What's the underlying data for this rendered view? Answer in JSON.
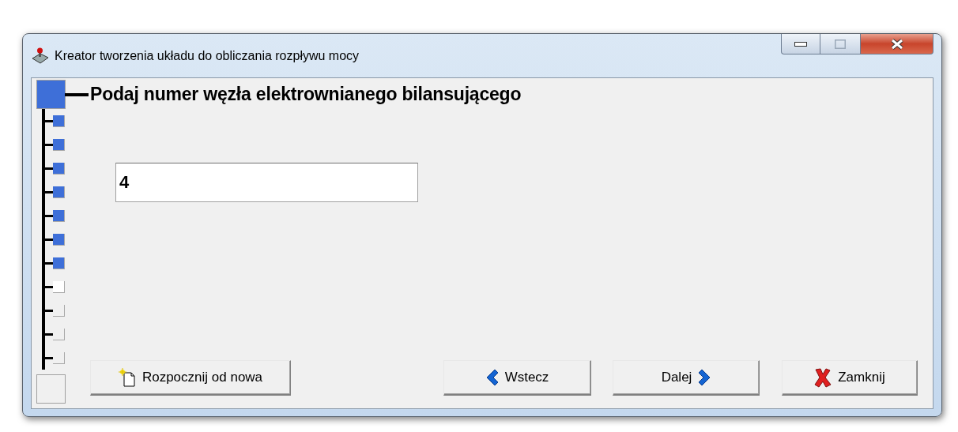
{
  "window": {
    "title": "Kreator tworzenia układu do obliczania rozpływu mocy"
  },
  "steps": [
    {
      "kind": "current"
    },
    {
      "kind": "done"
    },
    {
      "kind": "done"
    },
    {
      "kind": "done"
    },
    {
      "kind": "done"
    },
    {
      "kind": "done"
    },
    {
      "kind": "done"
    },
    {
      "kind": "done"
    },
    {
      "kind": "next"
    },
    {
      "kind": "pending"
    },
    {
      "kind": "pending"
    },
    {
      "kind": "pending"
    },
    {
      "kind": "end"
    }
  ],
  "prompt": "Podaj numer węzła elektrownianego bilansującego",
  "input": {
    "value": "4"
  },
  "buttons": [
    {
      "kind": "new",
      "label": "Rozpocznij od nowa"
    },
    {
      "kind": "back",
      "label": "Wstecz"
    },
    {
      "kind": "next",
      "label": "Dalej"
    },
    {
      "kind": "close",
      "label": "Zamknij"
    }
  ]
}
